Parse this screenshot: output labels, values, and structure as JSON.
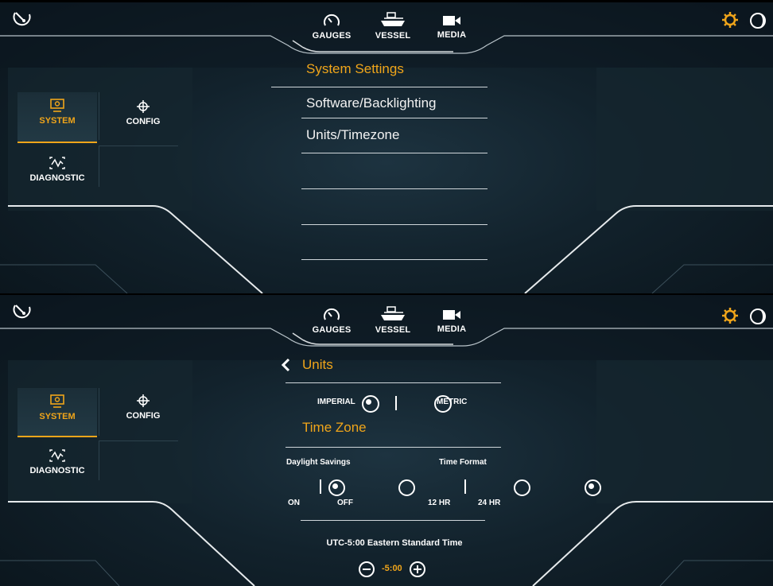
{
  "top_nav": {
    "gauges_label": "GAUGES",
    "vessel_label": "VESSEL",
    "media_label": "MEDIA"
  },
  "sidebar": {
    "system_label": "SYSTEM",
    "config_label": "CONFIG",
    "diagnostic_label": "DIAGNOSTIC"
  },
  "screen1": {
    "title": "System Settings",
    "menu_items": [
      "Software/Backlighting",
      "Units/Timezone"
    ]
  },
  "screen2": {
    "back_title": "Units",
    "units": {
      "imperial_label": "IMPERIAL",
      "metric_label": "METRIC",
      "selected": "IMPERIAL"
    },
    "time_zone_title": "Time Zone",
    "daylight_savings": {
      "label": "Daylight Savings",
      "on_label": "ON",
      "off_label": "OFF",
      "selected": "ON"
    },
    "time_format": {
      "label": "Time Format",
      "h12_label": "12 HR",
      "h24_label": "24 HR",
      "selected": "24 HR"
    },
    "timezone_name": "UTC-5:00 Eastern Standard Time",
    "offset_value": "-5:00"
  },
  "icons": [
    "gauge-speed-icon",
    "sun-gear-icon",
    "moon-icon",
    "gauge-icon",
    "boat-icon",
    "video-camera-icon",
    "monitor-gear-icon",
    "crosshair-icon",
    "waveform-icon",
    "chevron-left-icon",
    "minus-circle-icon",
    "plus-circle-icon"
  ],
  "colors": {
    "accent": "#f0a51a",
    "background": "#0f1d26",
    "text": "#ffffff"
  }
}
